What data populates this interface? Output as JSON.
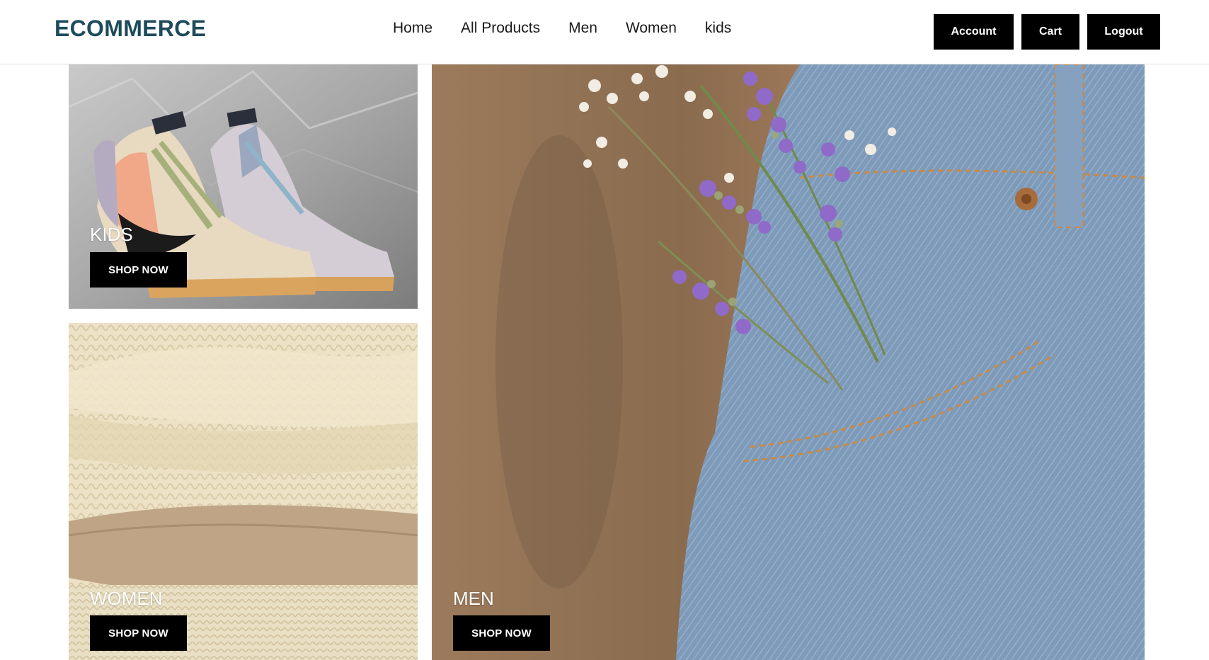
{
  "brand": "ECOMMERCE",
  "nav": {
    "links": [
      "Home",
      "All Products",
      "Men",
      "Women",
      "kids"
    ]
  },
  "actions": {
    "account": "Account",
    "cart": "Cart",
    "logout": "Logout"
  },
  "tiles": {
    "kids": {
      "label": "KIDS",
      "button": "SHOP NOW",
      "image": "sneakers-photo"
    },
    "women": {
      "label": "WOMEN",
      "button": "SHOP NOW",
      "image": "knit-sweaters-photo"
    },
    "men": {
      "label": "MEN",
      "button": "SHOP NOW",
      "image": "denim-pocket-flowers-photo"
    }
  },
  "colors": {
    "brand": "#1d4b5c",
    "button_bg": "#000000",
    "button_text": "#ffffff"
  }
}
